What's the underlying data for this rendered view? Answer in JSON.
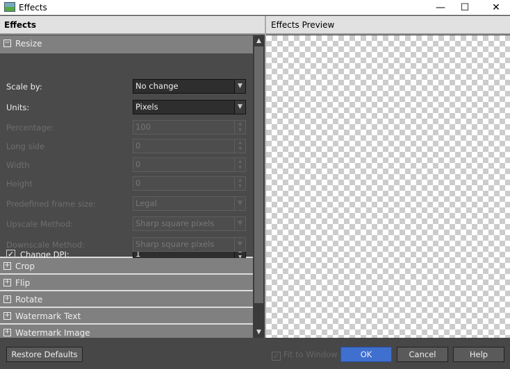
{
  "window": {
    "title": "Effects",
    "minimize": "—",
    "maximize": "☐",
    "close": "✕"
  },
  "panel": {
    "title": "Effects",
    "preview_title": "Effects Preview"
  },
  "resize": {
    "title": "Resize",
    "toggle": "−",
    "rows": [
      {
        "label": "Scale by:",
        "value": "No change",
        "type": "dropdown",
        "enabled": true
      },
      {
        "label": "Units:",
        "value": "Pixels",
        "type": "dropdown",
        "enabled": true
      },
      {
        "label": "Percentage:",
        "value": "100",
        "type": "spin",
        "enabled": false
      },
      {
        "label": "Long side",
        "value": "0",
        "type": "spin",
        "enabled": false
      },
      {
        "label": "Width",
        "value": "0",
        "type": "spin",
        "enabled": false
      },
      {
        "label": "Height",
        "value": "0",
        "type": "spin",
        "enabled": false
      },
      {
        "label": "Predefined frame size:",
        "value": "Legal",
        "type": "dropdown",
        "enabled": false
      },
      {
        "label": "Upscale Method:",
        "value": "Sharp square pixels",
        "type": "dropdown",
        "enabled": false
      },
      {
        "label": "Downscale Method:",
        "value": "Sharp square pixels",
        "type": "dropdown",
        "enabled": false
      }
    ],
    "change_dpi": {
      "label": "Change DPI:",
      "checked": true,
      "value": "1"
    }
  },
  "sections": [
    {
      "title": "Crop"
    },
    {
      "title": "Flip"
    },
    {
      "title": "Rotate"
    },
    {
      "title": "Watermark Text"
    },
    {
      "title": "Watermark Image"
    }
  ],
  "footer": {
    "restore": "Restore Defaults",
    "fit_to_window": "Fit to Window",
    "fit_checked": true,
    "ok": "OK",
    "cancel": "Cancel",
    "help": "Help"
  },
  "colors": {
    "accent": "#3f6fcf"
  }
}
